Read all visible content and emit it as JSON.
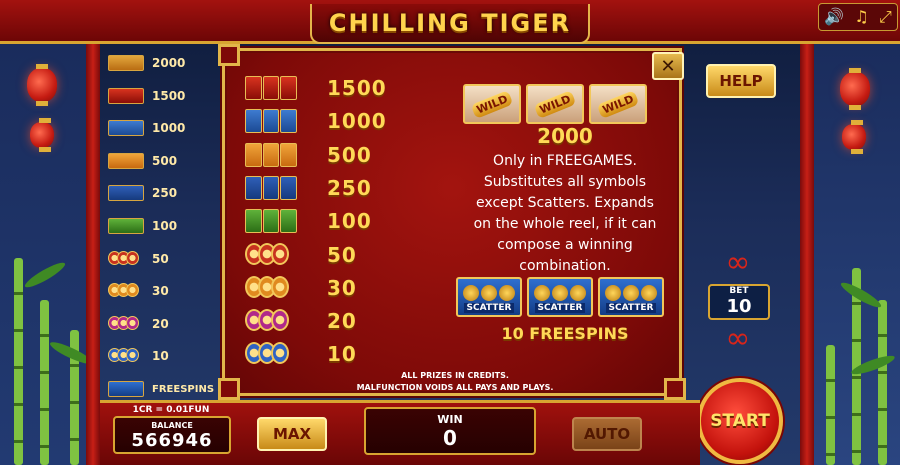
{
  "game": {
    "title": "CHILLING TIGER"
  },
  "system_buttons": [
    {
      "icon": "speaker-icon",
      "glyph": "🔊"
    },
    {
      "icon": "music-note-icon",
      "glyph": "♫"
    },
    {
      "icon": "fullscreen-icon",
      "glyph": "⤢"
    }
  ],
  "mini_paytable": [
    {
      "symbol": "dragon-card",
      "value": "2000"
    },
    {
      "symbol": "red-card",
      "value": "1500"
    },
    {
      "symbol": "tiger-card",
      "value": "1000"
    },
    {
      "symbol": "orange-card",
      "value": "500"
    },
    {
      "symbol": "yinyang-card",
      "value": "250"
    },
    {
      "symbol": "green-card",
      "value": "100"
    },
    {
      "symbol": "ring-A",
      "value": "50"
    },
    {
      "symbol": "ring-K",
      "value": "30"
    },
    {
      "symbol": "ring-Q",
      "value": "20"
    },
    {
      "symbol": "ring-J",
      "value": "10"
    },
    {
      "symbol": "scatter",
      "value": "FREESPINS"
    }
  ],
  "paytable": {
    "rows": [
      {
        "symbol": "red-card",
        "value": "1500"
      },
      {
        "symbol": "tiger-card",
        "value": "1000"
      },
      {
        "symbol": "orange-card",
        "value": "500"
      },
      {
        "symbol": "yinyang-card",
        "value": "250"
      },
      {
        "symbol": "green-card",
        "value": "100"
      },
      {
        "symbol": "ring-A",
        "value": "50"
      },
      {
        "symbol": "ring-K",
        "value": "30"
      },
      {
        "symbol": "ring-Q",
        "value": "20"
      },
      {
        "symbol": "ring-J",
        "value": "10"
      }
    ],
    "wild": {
      "badge": "WILD",
      "value": "2000",
      "description": [
        "Only in FREEGAMES.",
        "Substitutes all symbols",
        "except Scatters. Expands",
        "on the whole reel, if it can",
        "compose a winning",
        "combination."
      ]
    },
    "scatter": {
      "badge": "SCATTER",
      "label": "10 FREESPINS"
    },
    "footnotes": [
      "ALL PRIZES IN CREDITS.",
      "MALFUNCTION VOIDS ALL PAYS AND PLAYS."
    ],
    "close_label": "✕"
  },
  "controls": {
    "help_label": "HELP",
    "bet_label": "BET",
    "bet_value": "10",
    "start_label": "START",
    "max_label": "MAX",
    "auto_label": "AUTO"
  },
  "status": {
    "rate": "1CR = 0.01FUN",
    "balance_label": "BALANCE",
    "balance_value": "566946",
    "win_label": "WIN",
    "win_value": "0"
  },
  "colors": {
    "gold": "#ffd957",
    "frame": "#e2b64a",
    "panel": "#8a0c09",
    "red_knot": "#d8251a"
  }
}
